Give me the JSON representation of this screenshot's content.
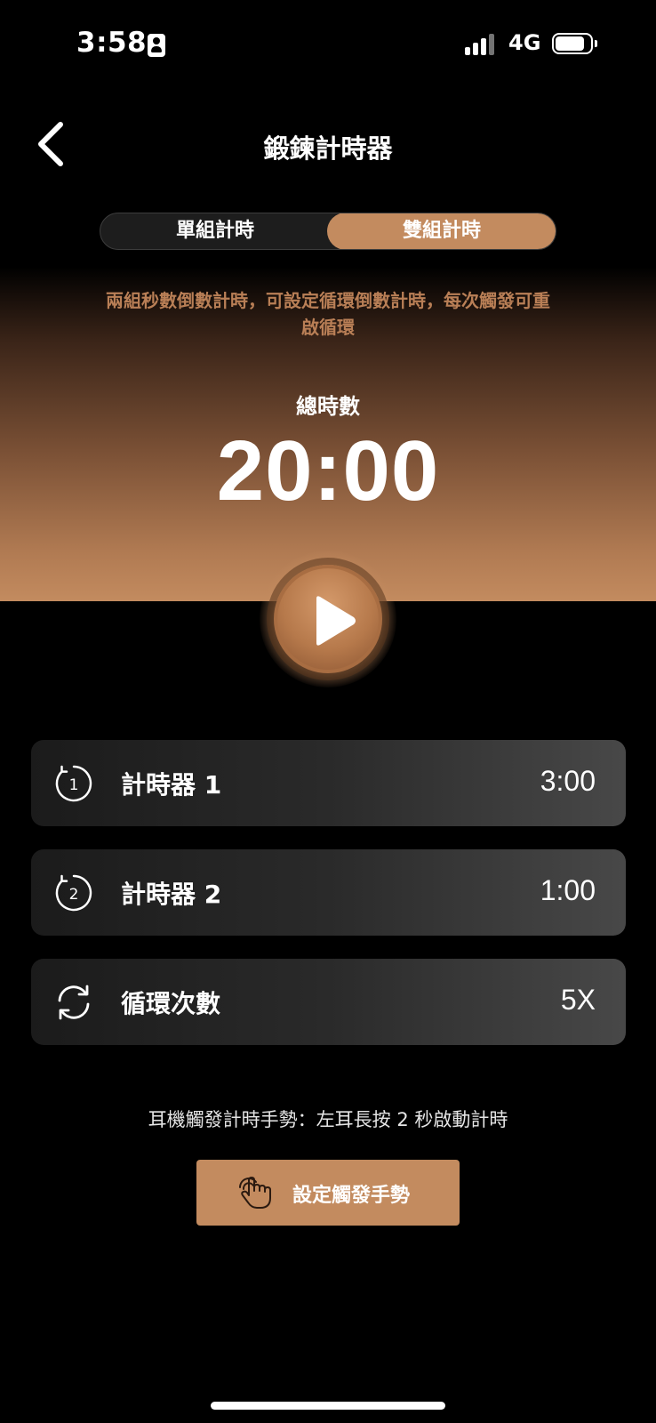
{
  "status_bar": {
    "time": "3:58",
    "network": "4G"
  },
  "header": {
    "title": "鍛鍊計時器"
  },
  "tabs": [
    {
      "label": "單組計時",
      "selected": false
    },
    {
      "label": "雙組計時",
      "selected": true
    }
  ],
  "description": "兩組秒數倒數計時，可設定循環倒數計時，每次觸發可重啟循環",
  "total": {
    "label": "總時數",
    "value": "20:00"
  },
  "settings": [
    {
      "label": "計時器 1",
      "value": "3:00",
      "icon": "timer-1-icon"
    },
    {
      "label": "計時器 2",
      "value": "1:00",
      "icon": "timer-2-icon"
    },
    {
      "label": "循環次數",
      "value": "5X",
      "icon": "repeat-icon"
    }
  ],
  "hint": "耳機觸發計時手勢：左耳長按 2 秒啟動計時",
  "gesture_button": {
    "label": "設定觸發手勢",
    "icon": "touch-gesture-icon"
  },
  "colors": {
    "accent": "#c38b5f",
    "background": "#000000"
  }
}
